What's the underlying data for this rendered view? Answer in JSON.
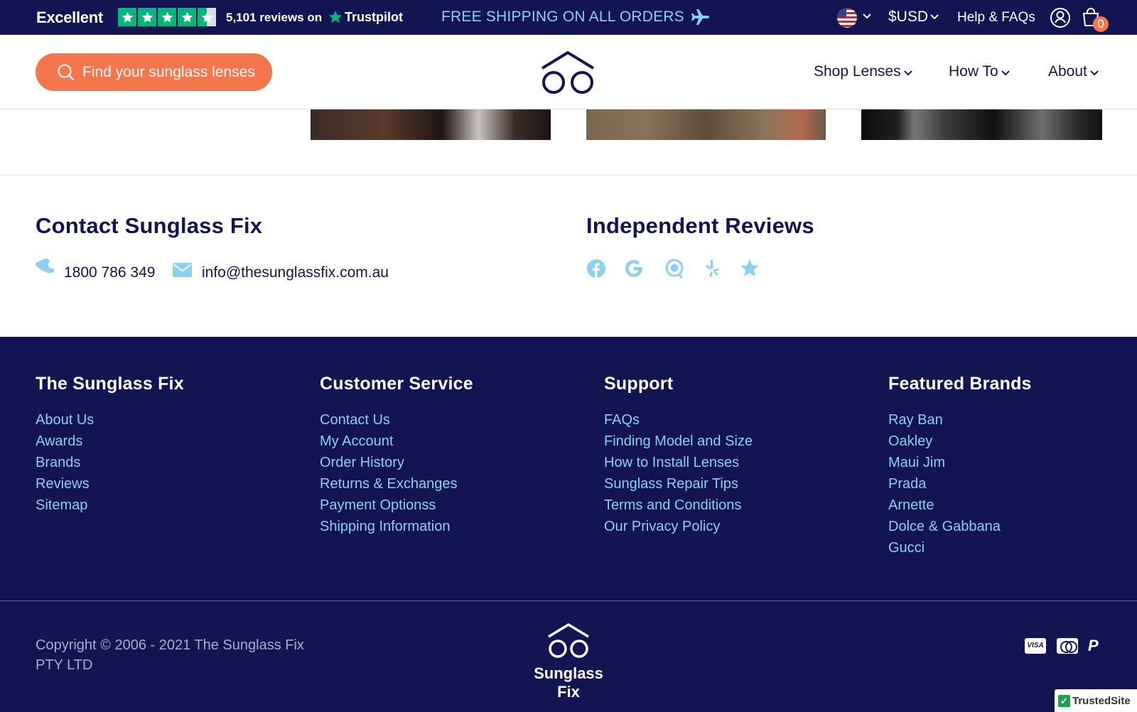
{
  "topbar": {
    "rating_word": "Excellent",
    "stars": 4.5,
    "reviews_text": "5,101 reviews on",
    "trustpilot_label": "Trustpilot",
    "shipping_text": "FREE SHIPPING ON ALL ORDERS",
    "currency": "$USD",
    "help_label": "Help & FAQs",
    "cart_count": "0"
  },
  "header": {
    "search_button": "Find your sunglass lenses",
    "nav": [
      {
        "label": "Shop Lenses"
      },
      {
        "label": "How To"
      },
      {
        "label": "About"
      }
    ]
  },
  "contact": {
    "title": "Contact Sunglass Fix",
    "phone": "1800 786 349",
    "email": "info@thesunglassfix.com.au"
  },
  "reviews": {
    "title": "Independent Reviews",
    "icons": [
      "facebook-icon",
      "google-icon",
      "productreview-icon",
      "yelp-icon",
      "star-icon"
    ]
  },
  "footer": {
    "columns": [
      {
        "title": "The Sunglass Fix",
        "links": [
          "About Us",
          "Awards",
          "Brands",
          "Reviews",
          "Sitemap"
        ]
      },
      {
        "title": "Customer Service",
        "links": [
          "Contact Us",
          "My Account",
          "Order History",
          "Returns & Exchanges",
          "Payment Optionss",
          "Shipping Information"
        ]
      },
      {
        "title": "Support",
        "links": [
          "FAQs",
          "Finding Model and Size",
          "How to Install Lenses",
          "Sunglass Repair Tips",
          "Terms and Conditions",
          "Our Privacy Policy"
        ]
      },
      {
        "title": "Featured Brands",
        "links": [
          "Ray Ban",
          "Oakley",
          "Maui Jim",
          "Prada",
          "Arnette",
          "Dolce & Gabbana",
          "Gucci"
        ]
      }
    ],
    "copyright": "Copyright © 2006 - 2021 The Sunglass Fix PTY LTD",
    "logo_text": "Sunglass Fix",
    "payments": {
      "visa": "VISA",
      "paypal": "P"
    },
    "trusted_site": "TrustedSite"
  },
  "colors": {
    "navy": "#131452",
    "accent": "#f5754c",
    "link": "#8ccff0",
    "trustpilot_green": "#00b67a"
  }
}
